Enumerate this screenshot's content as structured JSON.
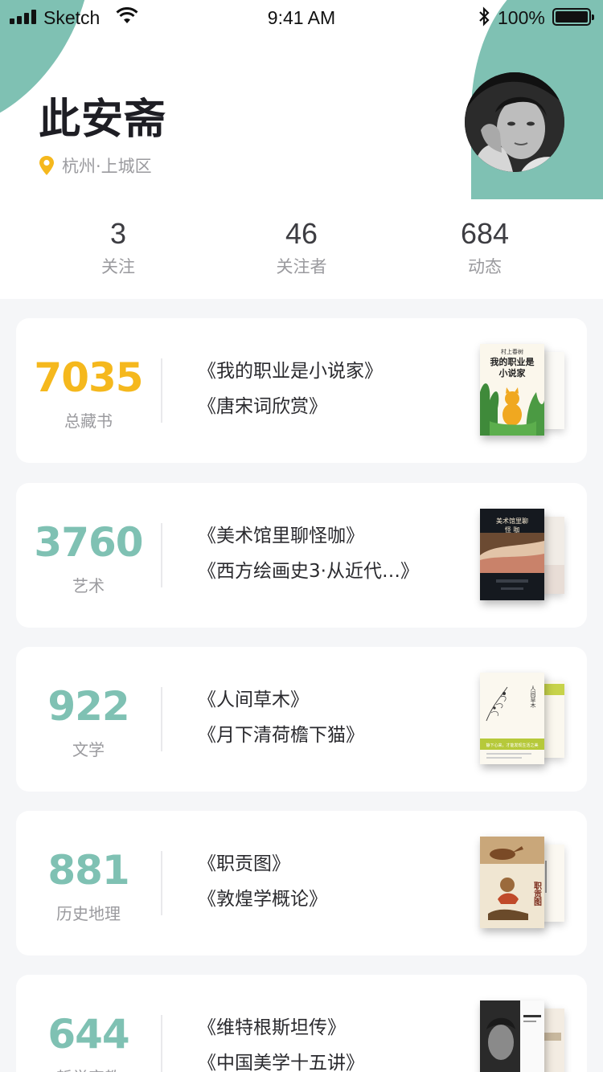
{
  "status_bar": {
    "carrier": "Sketch",
    "time": "9:41 AM",
    "battery": "100%"
  },
  "profile": {
    "name": "此安斋",
    "location": "杭州·上城区",
    "accent_color": "#7fc1b3"
  },
  "stats": [
    {
      "value": "3",
      "label": "关注"
    },
    {
      "value": "46",
      "label": "关注者"
    },
    {
      "value": "684",
      "label": "动态"
    }
  ],
  "collections": [
    {
      "count": "7035",
      "category": "总藏书",
      "color": "#f5b81d",
      "books": [
        "《我的职业是小说家》",
        "《唐宋词欣赏》"
      ]
    },
    {
      "count": "3760",
      "category": "艺术",
      "color": "#7fc1b3",
      "books": [
        "《美术馆里聊怪咖》",
        "《西方绘画史3·从近代…》"
      ]
    },
    {
      "count": "922",
      "category": "文学",
      "color": "#7fc1b3",
      "books": [
        "《人间草木》",
        "《月下清荷檐下猫》"
      ]
    },
    {
      "count": "881",
      "category": "历史地理",
      "color": "#7fc1b3",
      "books": [
        "《职贡图》",
        "《敦煌学概论》"
      ]
    },
    {
      "count": "644",
      "category": "哲学宗教",
      "color": "#7fc1b3",
      "books": [
        "《维特根斯坦传》",
        "《中国美学十五讲》"
      ]
    }
  ],
  "covers": {
    "c1_author": "村上春树",
    "c1_title_a": "我的职业是",
    "c1_title_b": "小说家",
    "c2_title_a": "美术馆里聊",
    "c2_title_b": "怪 咖",
    "c3_title": "人间草木",
    "c3_band": "静下心来，才能发现生活之美",
    "c4_title": "职贡图"
  }
}
